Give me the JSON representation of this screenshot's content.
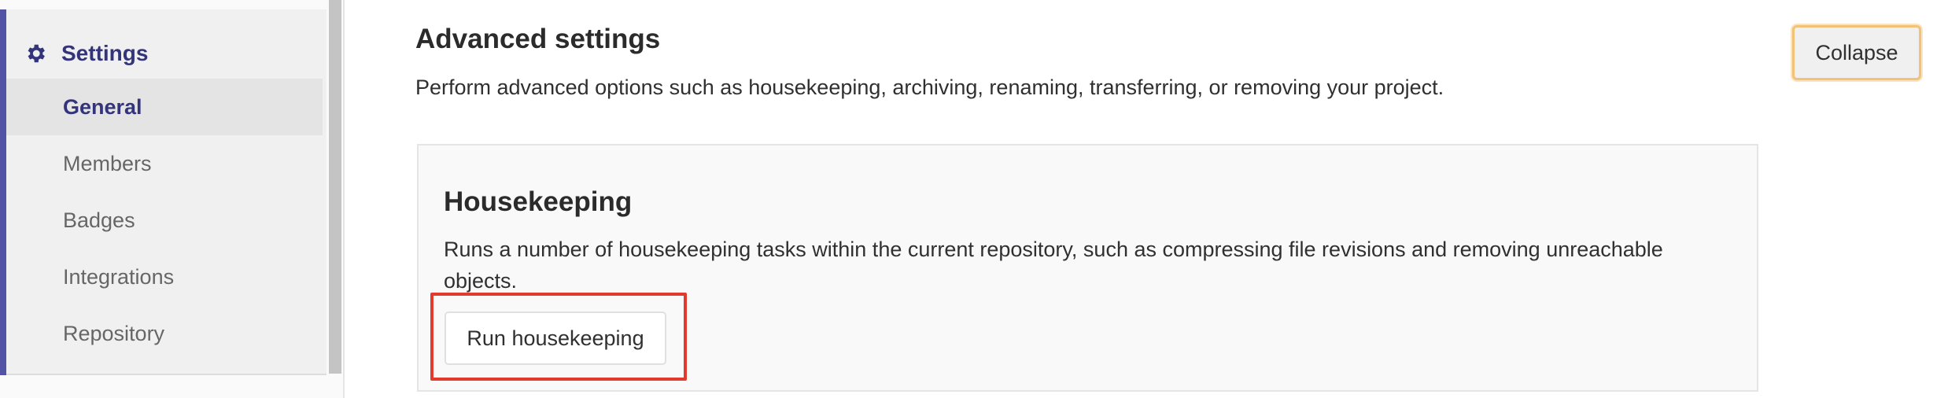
{
  "sidebar": {
    "title": "Settings",
    "items": [
      {
        "label": "General"
      },
      {
        "label": "Members"
      },
      {
        "label": "Badges"
      },
      {
        "label": "Integrations"
      },
      {
        "label": "Repository"
      }
    ]
  },
  "main": {
    "section_title": "Advanced settings",
    "section_description": "Perform advanced options such as housekeeping, archiving, renaming, transferring, or removing your project.",
    "collapse_label": "Collapse",
    "housekeeping": {
      "title": "Housekeeping",
      "description": "Runs a number of housekeeping tasks within the current repository, such as compressing file revisions and removing unreachable objects.",
      "button_label": "Run housekeeping"
    }
  },
  "colors": {
    "accent": "#5353a6",
    "highlight": "#e23b2e",
    "focus_ring": "#f3c27a"
  }
}
